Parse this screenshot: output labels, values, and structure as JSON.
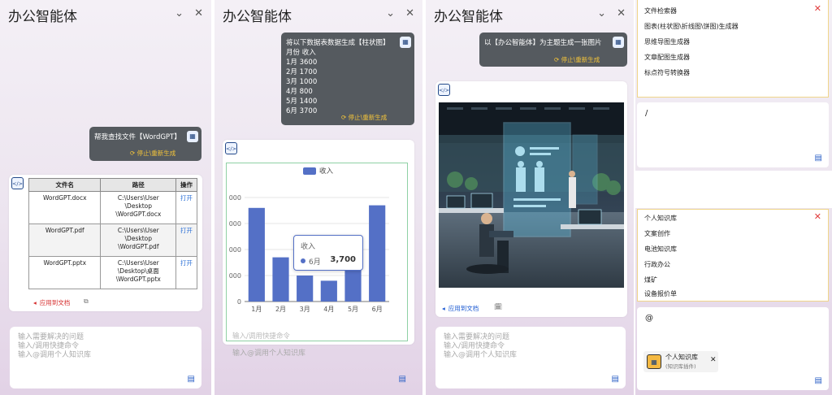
{
  "app_title": "办公智能体",
  "placeholder_lines": [
    "输入需要解决的问题",
    "输入/调用快捷命令",
    "输入@调用个人知识库"
  ],
  "apply_label": "应用到文档",
  "stop_label": "停止\\重新生成",
  "panel1": {
    "user_message": "帮我查找文件【WordGPT】",
    "table": {
      "headers": [
        "文件名",
        "路径",
        "操作"
      ],
      "rows": [
        {
          "name": "WordGPT.docx",
          "path_lines": [
            "C:\\Users\\User",
            "\\Desktop",
            "\\WordGPT.docx"
          ],
          "action": "打开"
        },
        {
          "name": "WordGPT.pdf",
          "path_lines": [
            "C:\\Users\\User",
            "\\Desktop",
            "\\WordGPT.pdf"
          ],
          "action": "打开"
        },
        {
          "name": "WordGPT.pptx",
          "path_lines": [
            "C:\\Users\\User",
            "\\Desktop\\桌面",
            "\\WordGPT.pptx"
          ],
          "action": "打开"
        }
      ]
    }
  },
  "panel2": {
    "user_message_lines": [
      "将以下数据表数据生成【柱状图】",
      "月份 收入",
      "1月 3600",
      "2月 1700",
      "3月 1000",
      "4月 800",
      "5月 1400",
      "6月 3700"
    ],
    "ghost_text": "输入/调用快捷命令",
    "tooltip": {
      "title": "收入",
      "label": "6月",
      "value": "3,700"
    }
  },
  "chart_data": {
    "type": "bar",
    "categories": [
      "1月",
      "2月",
      "3月",
      "4月",
      "5月",
      "6月"
    ],
    "series": [
      {
        "name": "收入",
        "values": [
          3600,
          1700,
          1000,
          800,
          1400,
          3700
        ]
      }
    ],
    "y_tick_labels": [
      "0",
      "000",
      "000",
      "000",
      "000"
    ],
    "ylim": [
      0,
      4000
    ],
    "legend": "top-center",
    "grid": true,
    "color": "#5470c6"
  },
  "panel3": {
    "user_message": "以【办公智能体】为主题生成一张图片"
  },
  "panel4": {
    "tools_list": [
      "文件检索器",
      "图表(柱状图\\折线图\\饼图)生成器",
      "思维导图生成器",
      "文章配图生成器",
      "标点符号转换器"
    ],
    "slash_input": "/",
    "kb_list": [
      "个人知识库",
      "文案创作",
      "电池知识库",
      "行政办公",
      "煤矿",
      "设备报价单"
    ],
    "at_input": "@",
    "chip": {
      "title": "个人知识库",
      "subtitle": "(知识库插件)"
    }
  },
  "icons": {
    "collapse": "chevron-down-icon",
    "close": "close-icon",
    "send": "send-icon",
    "code": "code-icon",
    "robot": "robot-icon"
  }
}
